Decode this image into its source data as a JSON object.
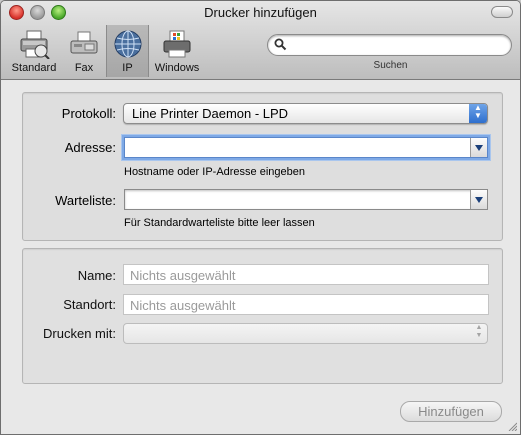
{
  "window": {
    "title": "Drucker hinzufügen"
  },
  "toolbar": {
    "items": [
      {
        "label": "Standard",
        "icon": "printer-icon"
      },
      {
        "label": "Fax",
        "icon": "fax-icon"
      },
      {
        "label": "IP",
        "icon": "globe-icon",
        "selected": true
      },
      {
        "label": "Windows",
        "icon": "windows-printer-icon"
      }
    ],
    "search": {
      "value": "",
      "placeholder": "",
      "caption": "Suchen"
    }
  },
  "protocol_group": {
    "protocol_label": "Protokoll:",
    "protocol_value": "Line Printer Daemon - LPD",
    "address_label": "Adresse:",
    "address_value": "",
    "address_hint": "Hostname oder IP-Adresse eingeben",
    "queue_label": "Warteliste:",
    "queue_value": "",
    "queue_hint": "Für Standardwarteliste bitte leer lassen"
  },
  "info_group": {
    "name_label": "Name:",
    "name_placeholder": "Nichts ausgewählt",
    "location_label": "Standort:",
    "location_placeholder": "Nichts ausgewählt",
    "print_with_label": "Drucken mit:",
    "print_with_value": ""
  },
  "actions": {
    "add_label": "Hinzufügen"
  },
  "colors": {
    "accent": "#2e6fce",
    "focus_ring": "#7ea9e6"
  }
}
